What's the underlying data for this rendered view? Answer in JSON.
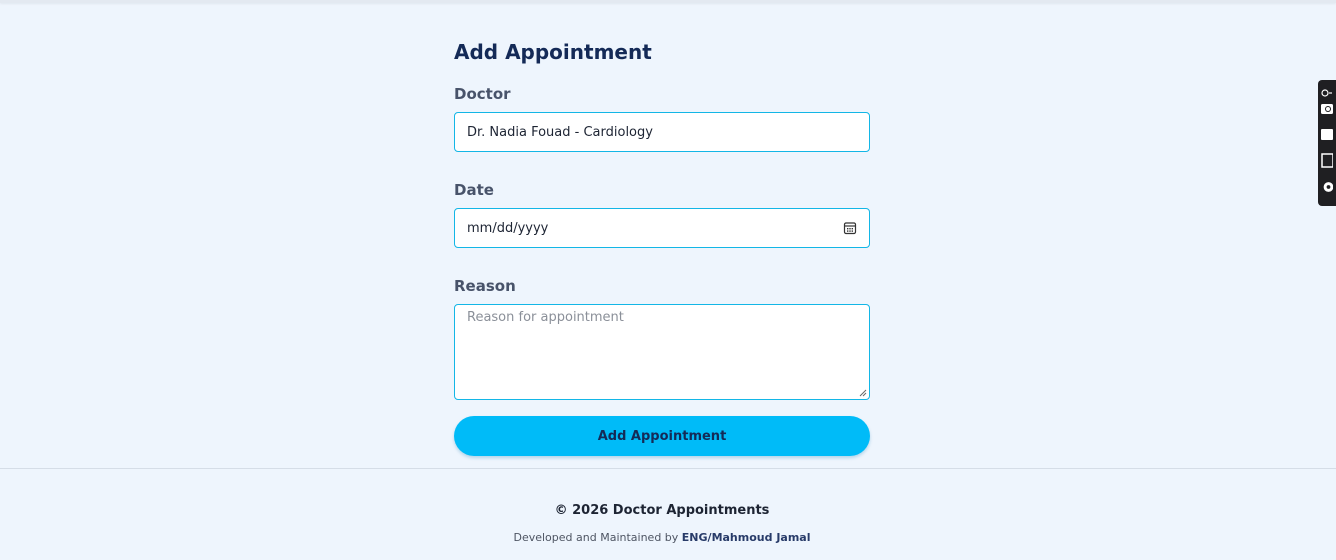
{
  "form": {
    "title": "Add Appointment",
    "doctor_label": "Doctor",
    "doctor_value": "Dr. Nadia Fouad - Cardiology",
    "date_label": "Date",
    "date_value": "mm/dd/yyyy",
    "reason_label": "Reason",
    "reason_placeholder": "Reason for appointment",
    "submit_label": "Add Appointment"
  },
  "footer": {
    "copyright": "© 2026 Doctor Appointments",
    "developed_by": "Developed and Maintained by",
    "author": "ENG/Mahmoud Jamal"
  },
  "colors": {
    "accent": "#00bbf8",
    "input_border": "#13b6e6",
    "heading": "#142a57",
    "background": "#eef5fd"
  },
  "icons": {
    "date_picker": "calendar-icon",
    "side_widget": [
      "link-icon",
      "camera-icon",
      "folder-icon",
      "square-icon",
      "gear-icon"
    ]
  }
}
